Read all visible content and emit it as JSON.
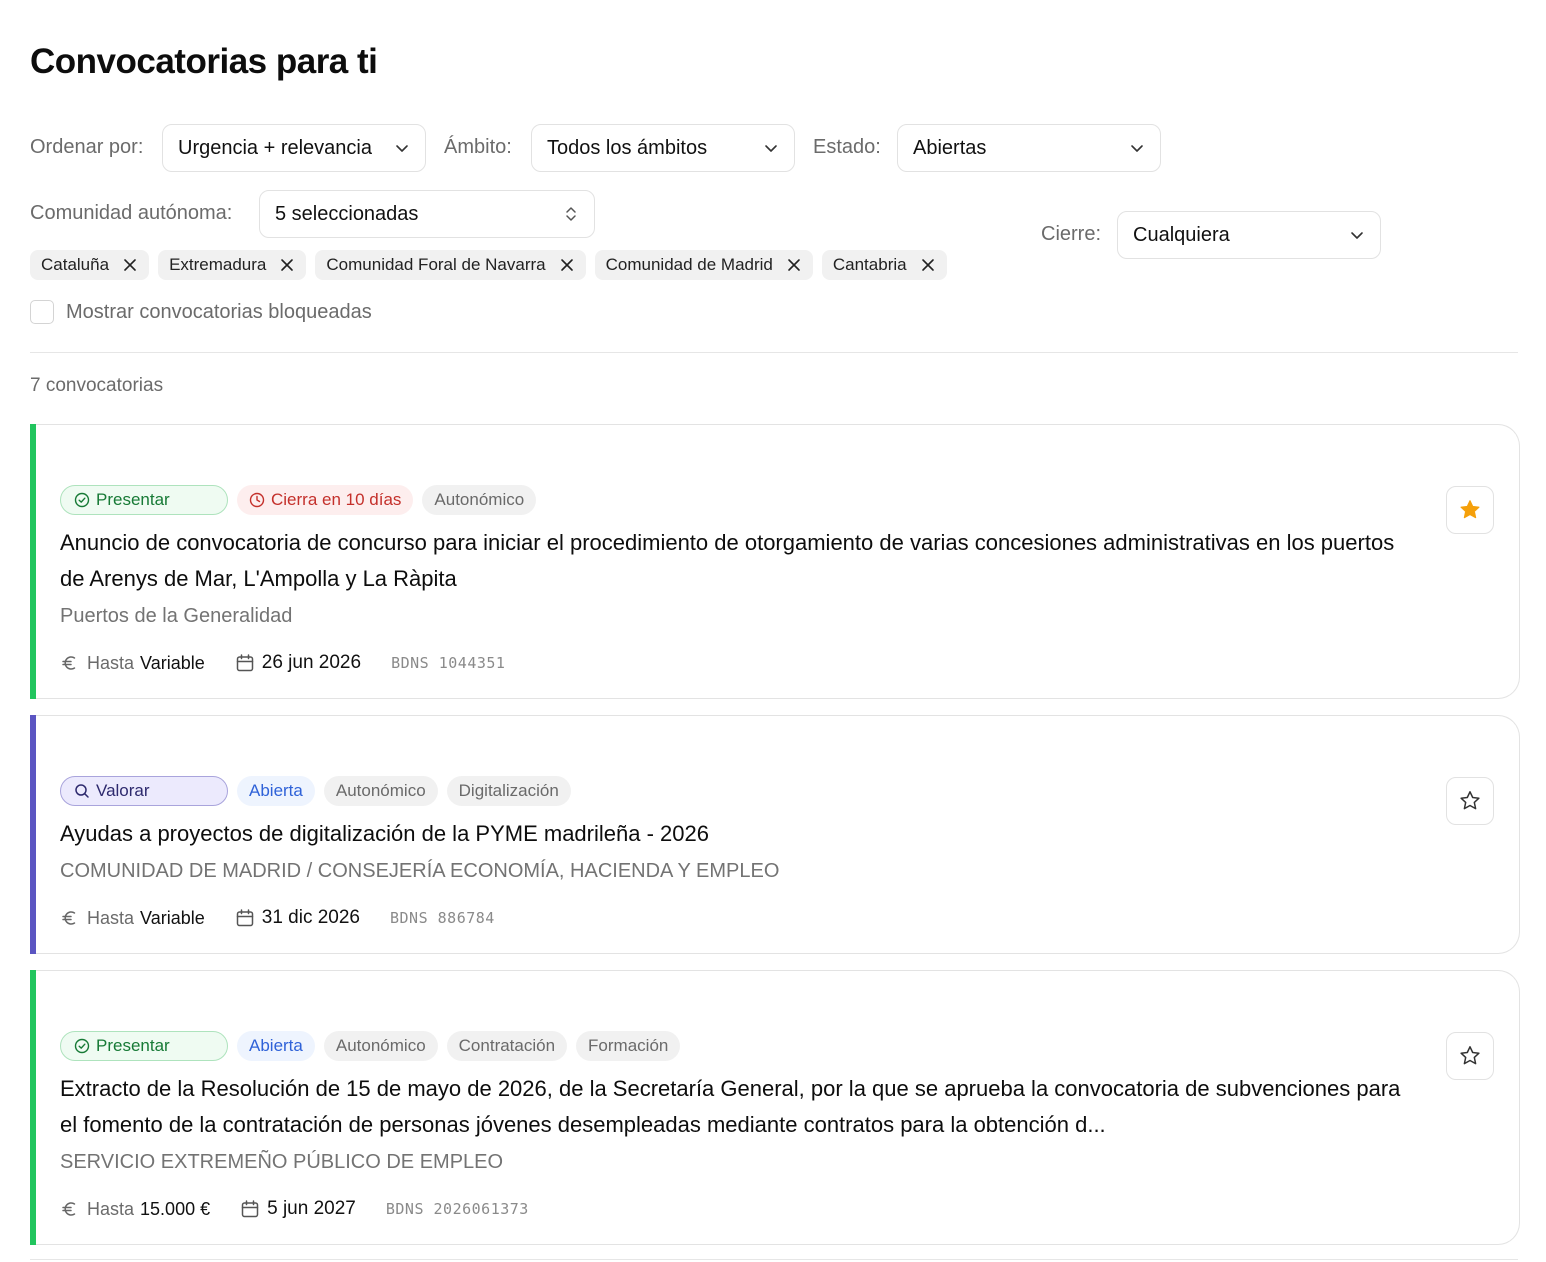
{
  "page": {
    "title": "Convocatorias para ti"
  },
  "filters": {
    "order": {
      "label": "Ordenar por:",
      "value": "Urgencia + relevancia"
    },
    "scope": {
      "label": "Ámbito:",
      "value": "Todos los ámbitos"
    },
    "status": {
      "label": "Estado:",
      "value": "Abiertas"
    },
    "region": {
      "label": "Comunidad autónoma:",
      "value": "5 seleccionadas"
    },
    "closing": {
      "label": "Cierre:",
      "value": "Cualquiera"
    },
    "chips": [
      "Cataluña",
      "Extremadura",
      "Comunidad Foral de Navarra",
      "Comunidad de Madrid",
      "Cantabria"
    ],
    "show_blocked": {
      "label": "Mostrar convocatorias bloqueadas",
      "checked": false
    }
  },
  "results": {
    "count_label": "7 convocatorias"
  },
  "colors": {
    "present_bar": "#22c55e",
    "valorar_bar": "#5b55c2",
    "star_active": "#f5a00b"
  },
  "cards": [
    {
      "action": "Presentar",
      "badges": [
        "Cierra en 10 días",
        "Autonómico"
      ],
      "title": "Anuncio de convocatoria de concurso para iniciar el procedimiento de otorgamiento de varias concesiones administrativas en los puertos de Arenys de Mar, L'Ampolla y La Ràpita",
      "organization": "Puertos de la Generalidad",
      "amount_label": "Hasta",
      "amount": "Variable",
      "deadline": "26 jun 2026",
      "bdns": "BDNS 1044351",
      "starred": true
    },
    {
      "action": "Valorar",
      "badges": [
        "Abierta",
        "Autonómico",
        "Digitalización"
      ],
      "title": "Ayudas a proyectos de digitalización de la PYME madrileña - 2026",
      "organization": "COMUNIDAD DE MADRID / CONSEJERÍA ECONOMÍA, HACIENDA Y EMPLEO",
      "amount_label": "Hasta",
      "amount": "Variable",
      "deadline": "31 dic 2026",
      "bdns": "BDNS 886784",
      "starred": false
    },
    {
      "action": "Presentar",
      "badges": [
        "Abierta",
        "Autonómico",
        "Contratación",
        "Formación"
      ],
      "title": "Extracto de la Resolución de 15 de mayo de 2026, de la Secretaría General, por la que se aprueba la convocatoria de subvenciones para el fomento de la contratación de personas jóvenes desempleadas mediante contratos para la obtención d...",
      "organization": "SERVICIO EXTREMEÑO PÚBLICO DE EMPLEO",
      "amount_label": "Hasta",
      "amount": "15.000 €",
      "deadline": "5 jun 2027",
      "bdns": "BDNS 2026061373",
      "starred": false
    }
  ]
}
